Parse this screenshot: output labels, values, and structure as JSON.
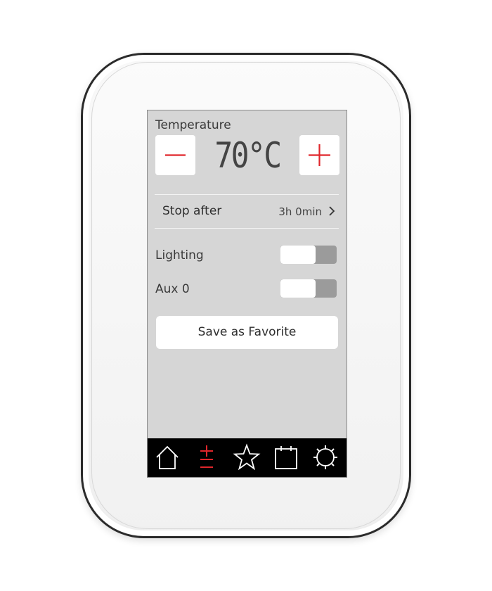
{
  "colors": {
    "accent": "#e0262b",
    "screen_bg": "#d6d6d6",
    "navbar_bg": "#000000",
    "toggle_track": "#9b9b9b"
  },
  "temperature": {
    "label": "Temperature",
    "value": "70°C",
    "decrease_icon": "minus-icon",
    "increase_icon": "plus-icon"
  },
  "stop_after": {
    "label": "Stop after",
    "value": "3h 0min",
    "icon": "chevron-right-icon"
  },
  "toggles": [
    {
      "label": "Lighting",
      "state": "off"
    },
    {
      "label": "Aux 0",
      "state": "off"
    }
  ],
  "favorite_button": {
    "label": "Save as Favorite"
  },
  "nav": [
    {
      "icon": "home-icon",
      "active": false
    },
    {
      "icon": "plus-minus-icon",
      "active": true
    },
    {
      "icon": "star-icon",
      "active": false
    },
    {
      "icon": "calendar-icon",
      "active": false
    },
    {
      "icon": "gear-icon",
      "active": false
    }
  ]
}
